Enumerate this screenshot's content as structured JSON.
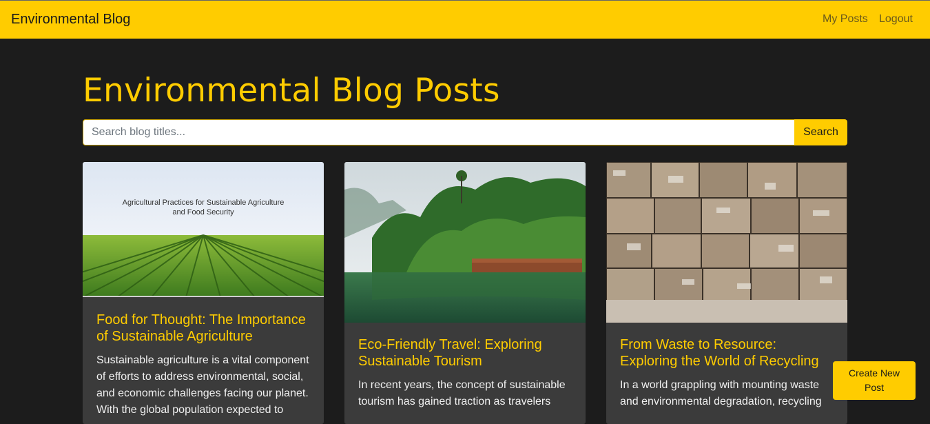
{
  "navbar": {
    "brand": "Environmental Blog",
    "links": [
      "My Posts",
      "Logout"
    ]
  },
  "page": {
    "title": "Environmental Blog Posts"
  },
  "search": {
    "placeholder": "Search blog titles...",
    "value": "",
    "button_label": "Search"
  },
  "posts": [
    {
      "image_caption": "Agricultural Practices for Sustainable Agriculture and Food Security",
      "title": "Food for Thought: The Importance of Sustainable Agriculture",
      "excerpt": "Sustainable agriculture is a vital component of efforts to address environmental, social, and economic challenges facing our planet. With the global population expected to"
    },
    {
      "title": "Eco-Friendly Travel: Exploring Sustainable Tourism",
      "excerpt": "In recent years, the concept of sustainable tourism has gained traction as travelers"
    },
    {
      "title": "From Waste to Resource: Exploring the World of Recycling",
      "excerpt": "In a world grappling with mounting waste and environmental degradation, recycling"
    }
  ],
  "create_button": {
    "label": "Create New Post"
  },
  "colors": {
    "accent": "#ffcc00",
    "background": "#1c1c1c",
    "card": "#3b3b3b"
  }
}
